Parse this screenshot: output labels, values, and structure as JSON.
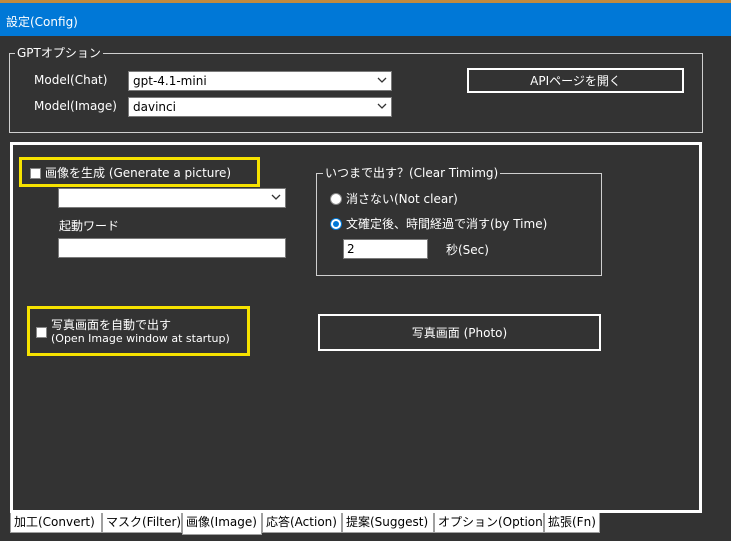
{
  "window": {
    "title": "設定(Config)"
  },
  "gpt_options": {
    "legend": "GPTオプション",
    "model_chat_label": "Model(Chat)",
    "model_chat_value": "gpt-4.1-mini",
    "model_image_label": "Model(Image)",
    "model_image_value": "davinci",
    "api_button": "APIページを開く"
  },
  "image_tab": {
    "generate_checkbox_label": "画像を生成 (Generate a picture)",
    "generate_checked": false,
    "generate_combo_value": "",
    "trigger_word_label": "起動ワード",
    "trigger_word_value": "",
    "clear_timing": {
      "legend": "いつまで出す？(Clear Timimg)",
      "option_not_clear": "消さない(Not clear)",
      "option_by_time": "文確定後、時間経過で消す(by Time)",
      "selected": "by_time",
      "seconds_value": "2",
      "seconds_unit": "秒(Sec)"
    },
    "auto_photo_label_line1": "写真画面を自動で出す",
    "auto_photo_label_line2": "(Open Image window at startup)",
    "auto_photo_checked": false,
    "photo_button": "写真画面 (Photo)"
  },
  "tabs": [
    {
      "label": "加工(Convert)"
    },
    {
      "label": "マスク(Filter)"
    },
    {
      "label": "画像(Image)",
      "active": true
    },
    {
      "label": "応答(Action)"
    },
    {
      "label": "提案(Suggest)"
    },
    {
      "label": "オプション(Option)"
    },
    {
      "label": "拡張(Fn)"
    }
  ],
  "colors": {
    "titlebar": "#0078d7",
    "background": "#333333",
    "highlight": "#f6e200"
  }
}
